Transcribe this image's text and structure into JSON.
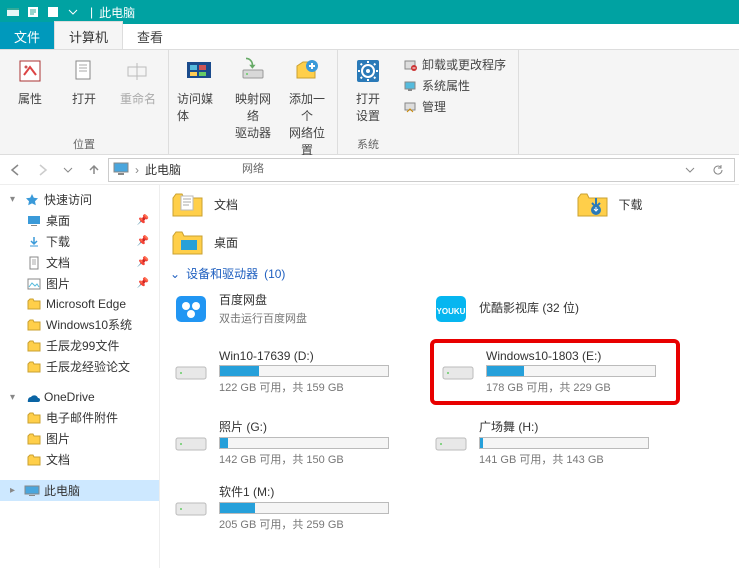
{
  "titlebar": {
    "title": "此电脑"
  },
  "tabs": {
    "file": "文件",
    "computer": "计算机",
    "view": "查看"
  },
  "ribbon": {
    "location": {
      "properties": "属性",
      "open": "打开",
      "rename": "重命名",
      "group": "位置"
    },
    "network": {
      "media": "访问媒体",
      "mapdrive": "映射网络\n驱动器",
      "addloc": "添加一个\n网络位置",
      "group": "网络"
    },
    "system": {
      "opensettings": "打开\n设置",
      "uninstall": "卸载或更改程序",
      "sysprops": "系统属性",
      "manage": "管理",
      "group": "系统"
    }
  },
  "address": {
    "root": "此电脑"
  },
  "tree": {
    "quick": "快速访问",
    "desktop": "桌面",
    "docs": "文档",
    "pics": "图片",
    "edge": "Microsoft Edge",
    "w10": "Windows10系统",
    "rcl99": "壬辰龙99文件",
    "rclexp": "壬辰龙经验论文",
    "download": "下载",
    "onedrive": "OneDrive",
    "email": "电子邮件附件",
    "pics2": "图片",
    "docs2": "文档",
    "thispc": "此电脑"
  },
  "folders": {
    "docs": "文档",
    "downloads": "下载",
    "desktop": "桌面"
  },
  "section": {
    "label": "设备和驱动器",
    "count": "(10)"
  },
  "drives": {
    "baidu": {
      "name": "百度网盘",
      "sub": "双击运行百度网盘"
    },
    "youku": {
      "name": "优酷影视库 (32 位)"
    },
    "d": {
      "name": "Win10-17639 (D:)",
      "sub": "122 GB 可用，共 159 GB",
      "pct": 23
    },
    "e": {
      "name": "Windows10-1803 (E:)",
      "sub": "178 GB 可用，共 229 GB",
      "pct": 22
    },
    "g": {
      "name": "照片 (G:)",
      "sub": "142 GB 可用，共 150 GB",
      "pct": 5
    },
    "h": {
      "name": "广场舞 (H:)",
      "sub": "141 GB 可用，共 143 GB",
      "pct": 2
    },
    "m": {
      "name": "软件1 (M:)",
      "sub": "205 GB 可用，共 259 GB",
      "pct": 21
    }
  }
}
